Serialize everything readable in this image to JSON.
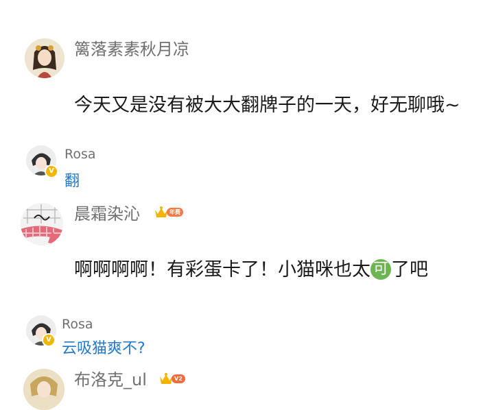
{
  "comments": [
    {
      "username": "篱落素素秋月凉",
      "avatar_icon": "anime-girl-avatar",
      "body": "今天又是没有被大大翻牌子的一天，好无聊哦~",
      "reply": {
        "username": "Rosa",
        "text": "翻",
        "badge": "V"
      }
    },
    {
      "username": "晨霜染沁",
      "avatar_icon": "plaid-scarf-avatar",
      "crown_badge": "年费",
      "body_before": "啊啊啊啊！有彩蛋卡了！小猫咪也太",
      "body_emoji": "可",
      "body_after": "了吧",
      "reply": {
        "username": "Rosa",
        "text": "云吸猫爽不?",
        "badge": "V"
      }
    },
    {
      "username": "布洛克_ul",
      "avatar_icon": "anime-avatar",
      "crown_badge": "V2"
    }
  ],
  "colors": {
    "username": "#6f6f6f",
    "reply_text": "#2478c9",
    "vip_badge": "#f2b705",
    "emoji_bg": "#6bb552"
  }
}
